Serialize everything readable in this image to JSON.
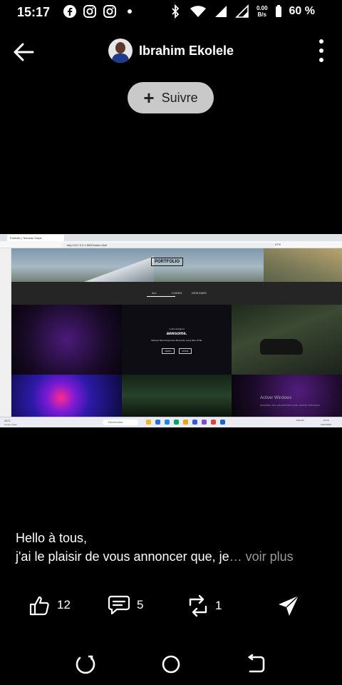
{
  "status_bar": {
    "time": "15:17",
    "net_speed_value": "0.00",
    "net_speed_unit": "B/s",
    "battery": "60 %",
    "left_icons": [
      "facebook-icon",
      "instagram-icon",
      "instagram-icon",
      "dot-icon"
    ],
    "right_icons": [
      "bluetooth-icon",
      "wifi-icon",
      "signal-icon",
      "signal-icon",
      "battery-icon"
    ]
  },
  "header": {
    "back_icon": "arrow-left-icon",
    "name": "Ibrahim Ekolele",
    "more_icon": "more-vertical-icon"
  },
  "follow_button": {
    "label": "Suivre",
    "icon": "plus-icon"
  },
  "post_image": {
    "tab_title": "Portfolio | Tenneau Gapic",
    "url": "http://127.0.0.1:5500/index.html",
    "zoom": "67%",
    "site_title": "PORTFOLIO",
    "filters": [
      "ALL",
      "CODED",
      "DESIGNED"
    ],
    "center_line1": "Looks designed",
    "center_line2": "awesome.",
    "center_line3": "Website Best Responsive Bootstrap using Web HTML",
    "center_btn1": "DEMO",
    "center_btn2": "MODE",
    "watermark_title": "Activer Windows",
    "watermark_sub": "Accédez aux paramètres pour activer Windows.",
    "taskbar_search": "Rechercher",
    "weather": "33°C",
    "weather_sub": "Temps risqué",
    "clock_time": "15:16",
    "clock_date": "12/07/2023",
    "lang": "FRA FR"
  },
  "post": {
    "line1": "Hello à tous,",
    "line2": "j'ai le plaisir de vous annoncer que, je",
    "ellipsis": "…",
    "see_more": "voir plus"
  },
  "actions": {
    "like_icon": "thumbs-up-icon",
    "like_count": "12",
    "comment_icon": "comment-icon",
    "comment_count": "5",
    "repost_icon": "repost-icon",
    "repost_count": "1",
    "send_icon": "send-icon"
  },
  "nav_bar": {
    "icons": [
      "recent-apps-icon",
      "home-icon",
      "back-icon"
    ]
  },
  "colors": {
    "background": "#000000",
    "follow_button_bg": "#c9c9c9",
    "see_more": "#9a9a9a"
  }
}
